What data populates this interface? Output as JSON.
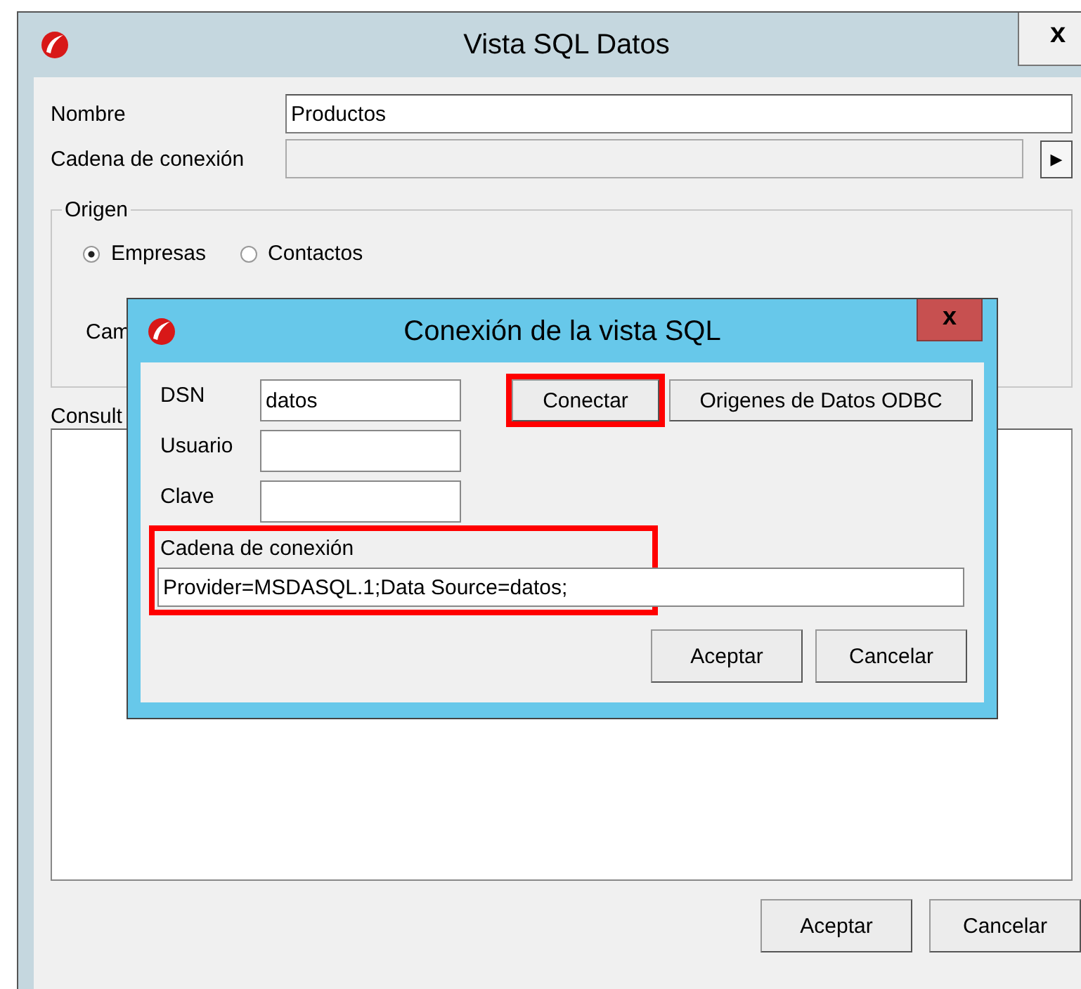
{
  "window": {
    "title": "Vista SQL Datos",
    "close": "x"
  },
  "form": {
    "name_label": "Nombre",
    "name_value": "Productos",
    "connection_label": "Cadena de conexión",
    "arrow": "▶",
    "group": {
      "title": "Origen",
      "radios": [
        {
          "label": "Empresas",
          "selected": true
        },
        {
          "label": "Contactos",
          "selected": false
        }
      ],
      "partial_label": "Cam"
    },
    "query_label": "Consult"
  },
  "buttons": [
    {
      "label": "Aceptar"
    },
    {
      "label": "Cancelar"
    }
  ],
  "dialog": {
    "title": "Conexión de la vista SQL",
    "close": "x",
    "fields": [
      {
        "label": "DSN",
        "value": "datos"
      },
      {
        "label": "Usuario"
      },
      {
        "label": "Clave"
      }
    ],
    "connect_button": {
      "label": "Conectar",
      "highlighted": true
    },
    "odbc_button": {
      "label": "Origenes de Datos ODBC"
    },
    "connection": {
      "label": "Cadena de conexión",
      "value": "Provider=MSDASQL.1;Data Source=datos;",
      "highlighted": true
    },
    "buttons": [
      {
        "label": "Aceptar"
      },
      {
        "label": "Cancelar"
      }
    ]
  }
}
